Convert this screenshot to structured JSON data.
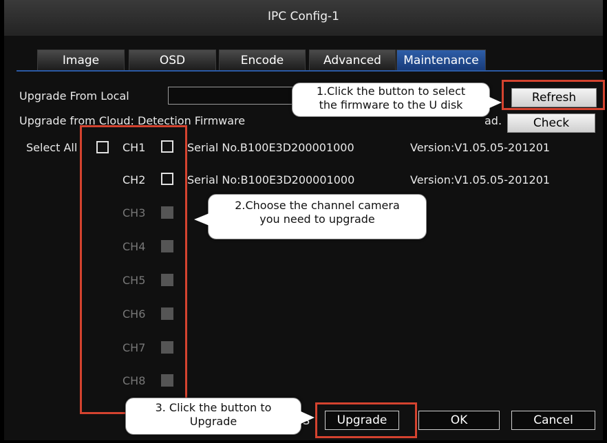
{
  "window": {
    "title": "IPC Config-1"
  },
  "tabs": [
    {
      "label": "Image",
      "active": false
    },
    {
      "label": "OSD",
      "active": false
    },
    {
      "label": "Encode",
      "active": false
    },
    {
      "label": "Advanced",
      "active": false
    },
    {
      "label": "Maintenance",
      "active": true
    }
  ],
  "upgrade_local": {
    "label": "Upgrade From Local",
    "refresh_label": "Refresh"
  },
  "upgrade_cloud": {
    "label": "Upgrade from Cloud: Detection Firmware",
    "tail_label": "ad.",
    "check_label": "Check"
  },
  "select_all_label": "Select All",
  "channels": [
    {
      "label": "CH1",
      "serial": "Serial No.B100E3D200001000",
      "version": "Version:V1.05.05-201201",
      "enabled": true
    },
    {
      "label": "CH2",
      "serial": "Serial No:B100E3D200001000",
      "version": "Version:V1.05.05-201201",
      "enabled": true
    },
    {
      "label": "CH3",
      "enabled": false
    },
    {
      "label": "CH4",
      "enabled": false
    },
    {
      "label": "CH5",
      "enabled": false
    },
    {
      "label": "CH6",
      "enabled": false
    },
    {
      "label": "CH7",
      "enabled": false
    },
    {
      "label": "CH8",
      "enabled": false
    }
  ],
  "footer": {
    "partial_label": "S",
    "upgrade_label": "Upgrade",
    "ok_label": "OK",
    "cancel_label": "Cancel"
  },
  "callouts": {
    "c1_line1": "1.Click the button to select",
    "c1_line2": "the firmware to the U disk",
    "c2_line1": "2.Choose the channel camera",
    "c2_line2": "you need to upgrade",
    "c3_line1": "3. Click the button to",
    "c3_line2": "Upgrade"
  },
  "colors": {
    "highlight": "#d4432f",
    "tab_active": "#2e5ea8"
  }
}
